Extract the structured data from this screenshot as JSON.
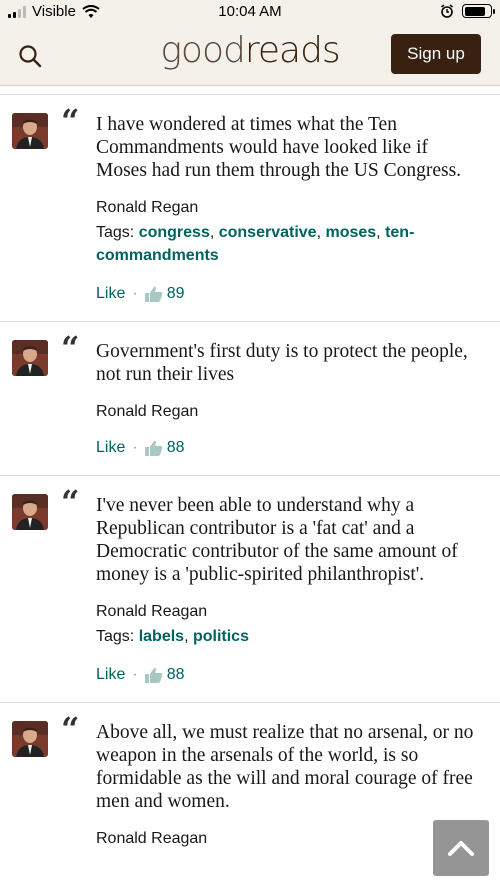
{
  "status_bar": {
    "carrier": "Visible",
    "time": "10:04 AM"
  },
  "header": {
    "logo_part1": "good",
    "logo_part2": "reads",
    "signup_label": "Sign up"
  },
  "quotes": [
    {
      "text": "I have wondered at times what the Ten Commandments would have looked like if Moses had run them through the US Congress.",
      "author": "Ronald Regan",
      "tags_label": "Tags:",
      "tags": [
        "congress",
        "conservative",
        "moses",
        "ten-commandments"
      ],
      "like_label": "Like",
      "likes": "89"
    },
    {
      "text": "Government's first duty is to protect the people, not run their lives",
      "author": "Ronald Regan",
      "like_label": "Like",
      "likes": "88"
    },
    {
      "text": "I've never been able to understand why a Republican contributor is a 'fat cat' and a Democratic contributor of the same amount of money is a 'public-spirited philanthropist'.",
      "author": "Ronald Reagan",
      "tags_label": "Tags:",
      "tags": [
        "labels",
        "politics"
      ],
      "like_label": "Like",
      "likes": "88"
    },
    {
      "text": "Above all, we must realize that no arsenal, or no weapon in the arsenals of the world, is so formidable as the will and moral courage of free men and women.",
      "author": "Ronald Reagan"
    }
  ],
  "colors": {
    "header_bg": "#f4f1ea",
    "brand_brown": "#382110",
    "link_green": "#00635d"
  },
  "icons": [
    "search-icon",
    "wifi-icon",
    "alarm-icon",
    "battery-icon",
    "thumbs-up-icon",
    "chevron-up-icon"
  ]
}
